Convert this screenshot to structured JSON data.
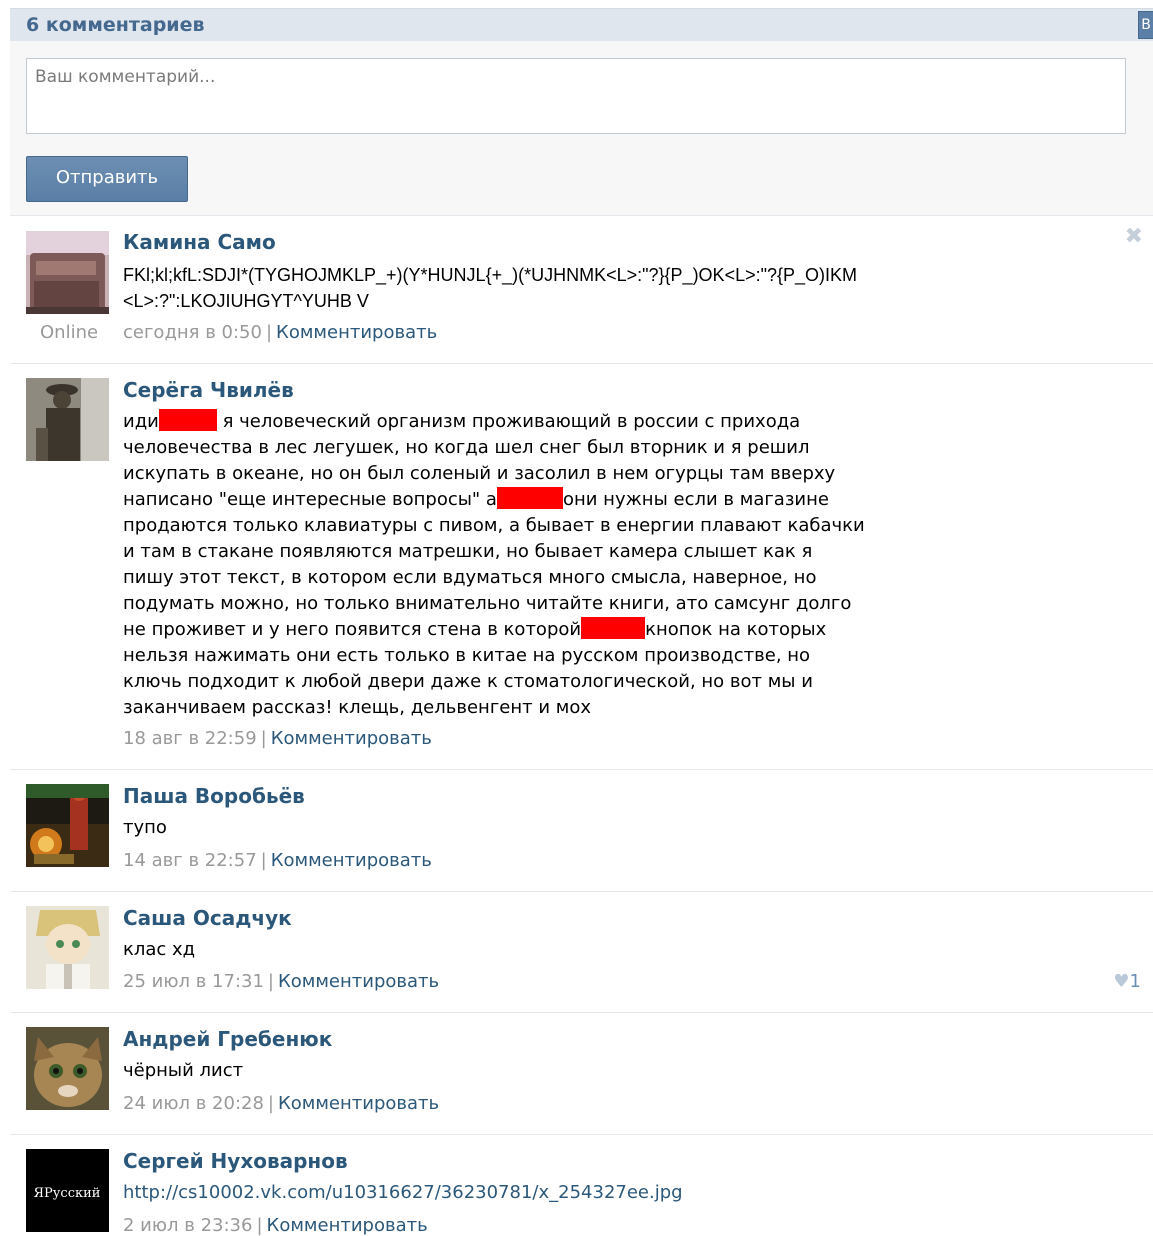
{
  "header": {
    "title": "6 комментариев",
    "corner_label": "В"
  },
  "composer": {
    "placeholder": "Ваш комментарий...",
    "send_label": "Отправить"
  },
  "reply_label": "Комментировать",
  "separator": "|",
  "comments": [
    {
      "author": "Камина Само",
      "text": "FKl;kl;kfL:SDJI*(TYGHOJMKLP_+)(Y*HUNJL{+_)(*UJHNMK<L>:\"?}{P_)OK<L>:\"?{P_O)IKM<L>:?\":LKOJIUHGYT^YUHB V",
      "date": "сегодня в 0:50",
      "status": "Online"
    },
    {
      "author": "Серёга Чвилёв",
      "text_parts": {
        "p1": "иди",
        "p2": " я человеческий организм проживающий в россии с прихода человечества в лес легушек, но когда шел снег был вторник и я решил искупать в океане, но он был соленый и засолил в нем огурцы там вверху написано \"еще интересные вопросы\" а",
        "p3": "они нужны если в магазине продаются только клавиатуры с пивом, а бывает в енергии плавают кабачки и там в стакане появляются матрешки, но бывает камера слышет как я пишу этот текст, в котором если вдуматься много смысла, наверное, но подумать можно, но только внимательно читайте книги, ато самсунг долго не проживет и у него появится стена в которой",
        "p4": "кнопок на которых нельзя нажимать они есть только в китае на русском производстве, но ключь подходит к любой двери даже к стоматологической, но вот мы и заканчиваем рассказ! клещь, дельвенгент и мох"
      },
      "date": "18 авг в 22:59"
    },
    {
      "author": "Паша Воробьёв",
      "text": "тупо",
      "date": "14 авг в 22:57"
    },
    {
      "author": "Саша Осадчук",
      "text": "клас хд",
      "date": "25 июл в 17:31",
      "likes": "1"
    },
    {
      "author": "Андрей Гребенюк",
      "text": "чёрный лист",
      "date": "24 июл в 20:28"
    },
    {
      "author": "Сергей Нуховарнов",
      "text": "http://cs10002.vk.com/u10316627/36230781/x_254327ee.jpg",
      "date": "2 июл в 23:36",
      "avatar_text": "ЯРусский"
    }
  ],
  "colors": {
    "link": "#2b587a",
    "header_bg": "#dfe6ee",
    "button": "#5a7ea6",
    "redaction": "#ff0000"
  }
}
